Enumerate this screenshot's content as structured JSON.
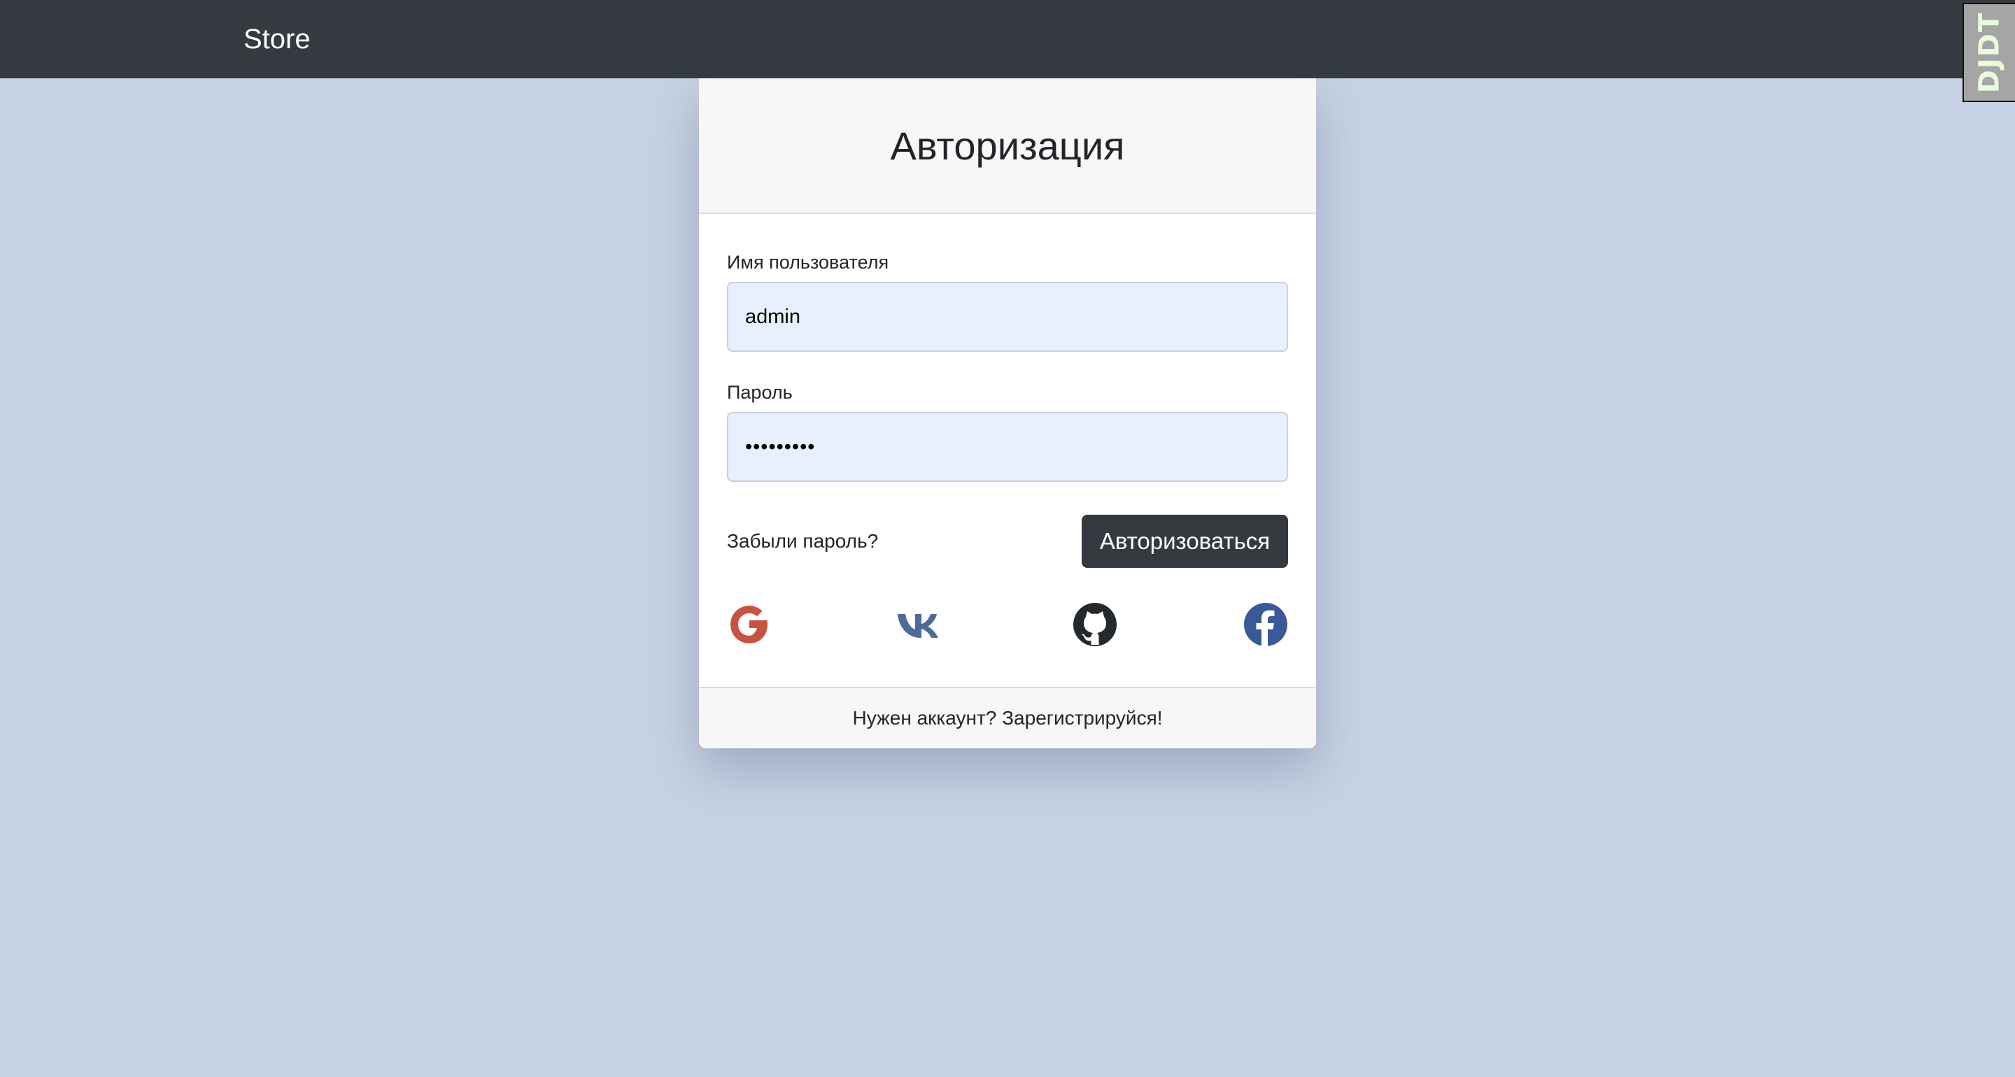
{
  "navbar": {
    "brand": "Store"
  },
  "debug_toolbar": {
    "label": "DJDT"
  },
  "login_card": {
    "title": "Авторизация",
    "username_label": "Имя пользователя",
    "username_value": "admin",
    "password_label": "Пароль",
    "password_value": "•••••••••",
    "forgot_link": "Забыли пароль?",
    "submit_label": "Авторизоваться",
    "social_logins": [
      {
        "icon": "google-icon",
        "color": "#c5533f"
      },
      {
        "icon": "vk-icon",
        "color": "#4c6b98"
      },
      {
        "icon": "github-icon",
        "color": "#24292e"
      },
      {
        "icon": "facebook-icon",
        "color": "#3b5998"
      }
    ],
    "footer_link": "Нужен аккаунт? Зарегистрируйся!"
  },
  "colors": {
    "page_background": "#c7d2e4",
    "navbar": "#343a40",
    "input_background": "#e8f0fe",
    "button": "#343a40"
  }
}
